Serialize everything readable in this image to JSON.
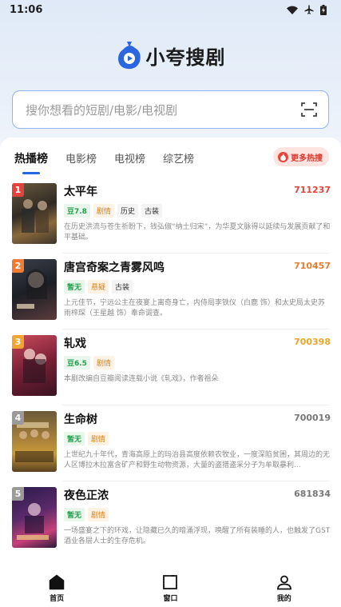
{
  "status": {
    "time": "11:06"
  },
  "app": {
    "name": "小夸搜剧"
  },
  "search": {
    "placeholder": "搜你想看的短剧/电影/电视剧"
  },
  "tabs": [
    {
      "label": "热播榜",
      "active": true
    },
    {
      "label": "电影榜",
      "active": false
    },
    {
      "label": "电视榜",
      "active": false
    },
    {
      "label": "综艺榜",
      "active": false
    }
  ],
  "more_hot": {
    "label": "更多热搜"
  },
  "colors": {
    "accent": "#2a66e0",
    "rank1": "#e0443a",
    "rank2": "#ef7b35",
    "rank3": "#f0a531",
    "rankOther": "#9a9a9a",
    "heatTop": "#e0443a",
    "heatMid": "#e77b2e",
    "heat3": "#e9a52c",
    "heatOther": "#777777"
  },
  "items": [
    {
      "rank": "1",
      "title": "太平年",
      "heat": "711237",
      "tags": [
        "豆7.8",
        "剧情",
        "历史",
        "古装"
      ],
      "desc": "在历史洪流与苍生祈盼下，钱弘俶“纳土归宋”，为华夏文脉得以延续与发展贡献了和平基础。"
    },
    {
      "rank": "2",
      "title": "唐宫奇案之青雾风鸣",
      "heat": "710457",
      "tags": [
        "暂无",
        "悬疑",
        "古装"
      ],
      "desc": "上元佳节，宁远公主在夜宴上离奇身亡，内侍局李铁仪（白鹿 饰）和太史局太史苏雨梓琛（王星越 饰）奉命调查。"
    },
    {
      "rank": "3",
      "title": "轧戏",
      "heat": "700398",
      "tags": [
        "豆6.5",
        "剧情"
      ],
      "desc": "本剧改编自豆瓣阅读连载小说《轧戏》，作者祖朵"
    },
    {
      "rank": "4",
      "title": "生命树",
      "heat": "700019",
      "tags": [
        "暂无",
        "剧情"
      ],
      "desc": "上世纪九十年代，青海高原上的玛治县高度依赖农牧业，一度深陷贫困，其周边的无人区博拉木拉富含矿产和野生动物资源，大量的盗猎盗采分子为牟取暴利..."
    },
    {
      "rank": "5",
      "title": "夜色正浓",
      "heat": "681834",
      "tags": [
        "暂无",
        "剧情"
      ],
      "desc": "一场盛宴之下的环戏，让隐藏已久的暗涌浮现，唤醒了所有装睡的人，也触发了GST酒业各层人士的生存危机。"
    }
  ],
  "nav": [
    {
      "label": "首页",
      "icon": "home-icon"
    },
    {
      "label": "窗口",
      "icon": "window-icon"
    },
    {
      "label": "我的",
      "icon": "profile-icon"
    }
  ]
}
